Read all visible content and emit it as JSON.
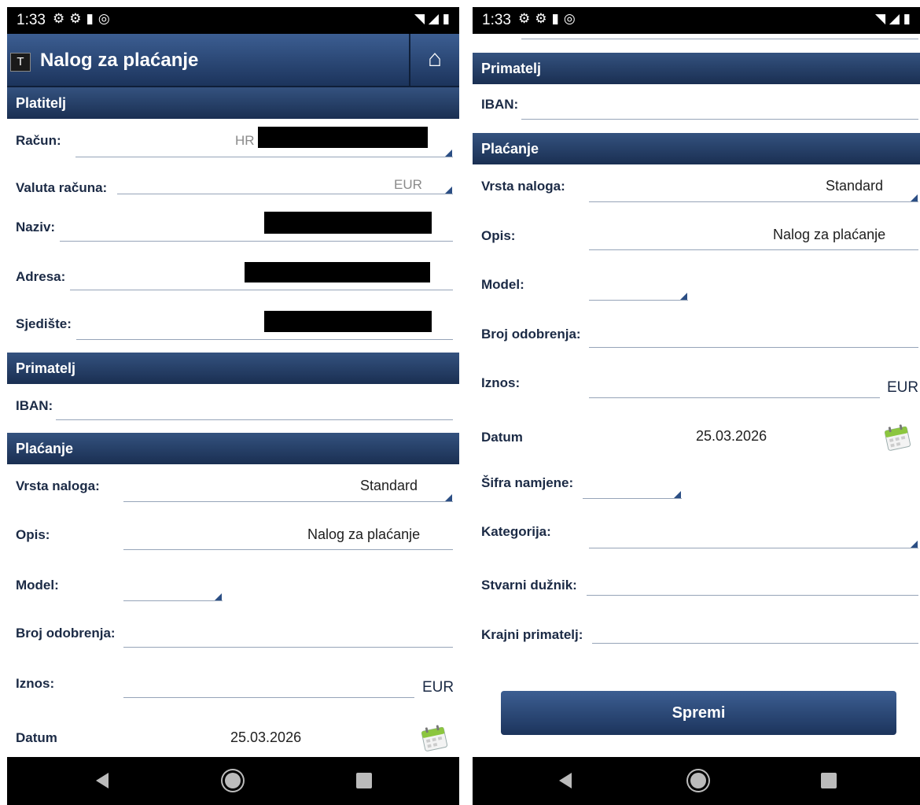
{
  "status": {
    "time": "1:33"
  },
  "app": {
    "title": "Nalog za plaćanje",
    "logo_letter": "T"
  },
  "sections": {
    "payer": "Platitelj",
    "recipient": "Primatelj",
    "payment": "Plaćanje"
  },
  "payer": {
    "account_label": "Račun:",
    "account_value": "HR",
    "currency_label": "Valuta računa:",
    "currency_value": "EUR",
    "name_label": "Naziv:",
    "address_label": "Adresa:",
    "seat_label": "Sjedište:"
  },
  "recipient": {
    "iban_label": "IBAN:"
  },
  "payment": {
    "order_type_label": "Vrsta naloga:",
    "order_type_value": "Standard",
    "description_label": "Opis:",
    "description_value": "Nalog za plaćanje",
    "model_label": "Model:",
    "approval_label": "Broj odobrenja:",
    "amount_label": "Iznos:",
    "amount_currency": "EUR",
    "date_label": "Datum",
    "date_value": "25.03.2026",
    "purpose_label": "Šifra namjene:",
    "category_label": "Kategorija:",
    "actual_debtor_label": "Stvarni dužnik:",
    "final_recipient_label": "Krajni primatelj:"
  },
  "save_button": "Spremi",
  "icons": [
    "settings-icon",
    "settings-icon",
    "sd-card-icon",
    "sync-icon",
    "wifi-icon",
    "signal-icon",
    "battery-icon",
    "home-icon",
    "calendar-icon",
    "dropdown-arrow-icon",
    "nav-back-icon",
    "nav-home-icon",
    "nav-recents-icon"
  ],
  "colors": {
    "header_top": "#3c5e92",
    "header_bottom": "#1a2f52",
    "label": "#1b2a45"
  }
}
